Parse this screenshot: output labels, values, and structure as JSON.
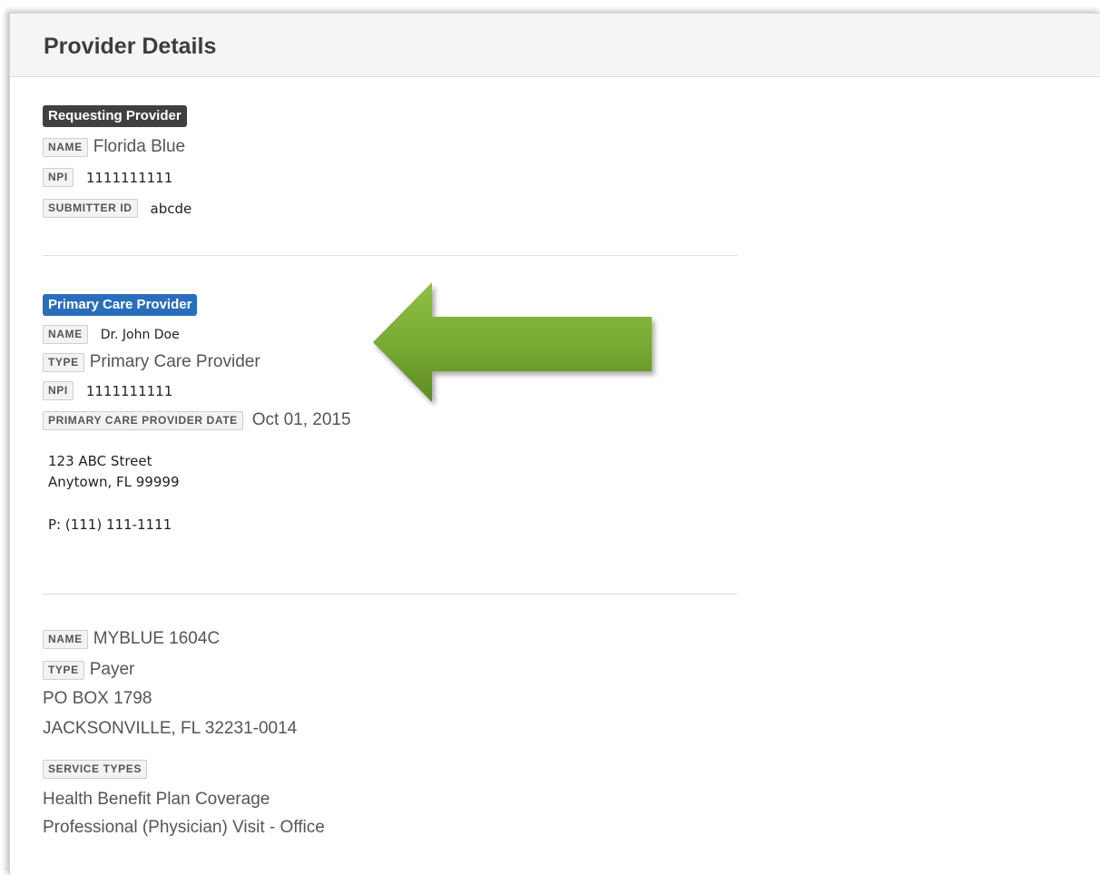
{
  "panel": {
    "title": "Provider Details"
  },
  "requesting_provider": {
    "badge": "Requesting Provider",
    "name_label": "NAME",
    "name": "Florida Blue",
    "npi_label": "NPI",
    "npi": "1111111111",
    "submitter_label": "SUBMITTER ID",
    "submitter_id": "abcde"
  },
  "primary_care_provider": {
    "badge": "Primary Care Provider",
    "name_label": "NAME",
    "name": "Dr. John Doe",
    "type_label": "TYPE",
    "type": "Primary Care Provider",
    "npi_label": "NPI",
    "npi": "1111111111",
    "date_label": "PRIMARY CARE PROVIDER DATE",
    "date": "Oct 01, 2015",
    "address_line1": "123 ABC Street",
    "address_line2": "Anytown, FL 99999",
    "phone": "P: (111) 111-1111"
  },
  "payer": {
    "name_label": "NAME",
    "name": "MYBLUE 1604C",
    "type_label": "TYPE",
    "type": "Payer",
    "address_line1": "PO BOX 1798",
    "address_line2": "JACKSONVILLE, FL 32231-0014",
    "service_types_label": "SERVICE TYPES",
    "service_types": [
      "Health Benefit Plan Coverage",
      "Professional (Physician) Visit - Office"
    ]
  },
  "colors": {
    "arrow": "#77a832",
    "badge_dark": "#404040",
    "badge_blue": "#2a6ebb"
  },
  "icons": {
    "pointer": "left-arrow-icon"
  }
}
